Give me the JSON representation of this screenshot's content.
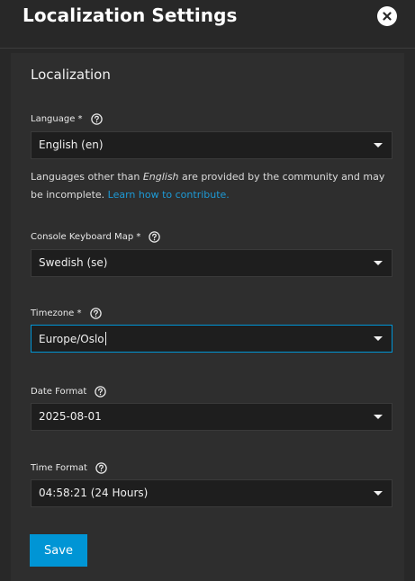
{
  "dialog": {
    "title": "Localization Settings",
    "close_icon": "close-circle-icon"
  },
  "card": {
    "title": "Localization"
  },
  "fields": {
    "language": {
      "label": "Language *",
      "value": "English (en)",
      "help_icon": "help-circle-icon"
    },
    "hint": {
      "prefix": "Languages other than ",
      "emphasis": "English",
      "suffix": " are provided by the community and may be incomplete. ",
      "link": "Learn how to contribute."
    },
    "keyboard": {
      "label": "Console Keyboard Map *",
      "value": "Swedish (se)",
      "help_icon": "help-circle-icon"
    },
    "timezone": {
      "label": "Timezone *",
      "value": "Europe/Oslo",
      "help_icon": "help-circle-icon"
    },
    "date_format": {
      "label": "Date Format",
      "value": "2025-08-01",
      "help_icon": "help-circle-icon"
    },
    "time_format": {
      "label": "Time Format",
      "value": "04:58:21 (24 Hours)",
      "help_icon": "help-circle-icon"
    }
  },
  "actions": {
    "save_label": "Save"
  },
  "colors": {
    "accent": "#0095d5",
    "link": "#1d9ad6",
    "background": "#282828",
    "card": "#2e2e2e",
    "input": "#1e1e1e"
  }
}
